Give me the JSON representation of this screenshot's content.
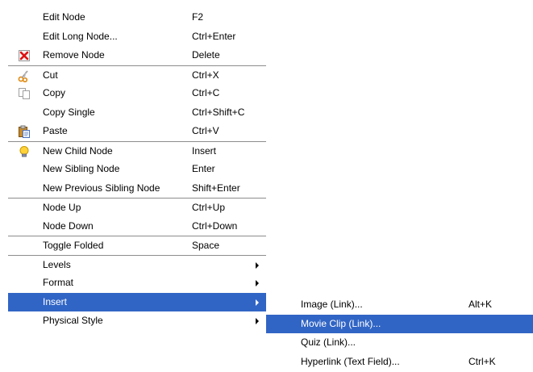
{
  "context_menu": {
    "items": [
      {
        "label": "Edit Node",
        "shortcut": "F2"
      },
      {
        "label": "Edit Long Node...",
        "shortcut": "Ctrl+Enter"
      },
      {
        "label": "Remove Node",
        "shortcut": "Delete",
        "icon": "remove-icon"
      },
      {
        "label": "Cut",
        "shortcut": "Ctrl+X",
        "icon": "scissors-icon"
      },
      {
        "label": "Copy",
        "shortcut": "Ctrl+C",
        "icon": "copy-icon"
      },
      {
        "label": "Copy Single",
        "shortcut": "Ctrl+Shift+C"
      },
      {
        "label": "Paste",
        "shortcut": "Ctrl+V",
        "icon": "paste-icon"
      },
      {
        "label": "New Child Node",
        "shortcut": "Insert",
        "icon": "lightbulb-icon"
      },
      {
        "label": "New Sibling Node",
        "shortcut": "Enter"
      },
      {
        "label": "New Previous Sibling Node",
        "shortcut": "Shift+Enter"
      },
      {
        "label": "Node Up",
        "shortcut": "Ctrl+Up"
      },
      {
        "label": "Node Down",
        "shortcut": "Ctrl+Down"
      },
      {
        "label": "Toggle Folded",
        "shortcut": "Space"
      },
      {
        "label": "Levels"
      },
      {
        "label": "Format"
      },
      {
        "label": "Insert"
      },
      {
        "label": "Physical Style"
      }
    ]
  },
  "insert_submenu": {
    "items": [
      {
        "label": "Image (Link)...",
        "shortcut": "Alt+K"
      },
      {
        "label": "Movie Clip (Link)...",
        "shortcut": ""
      },
      {
        "label": "Quiz (Link)...",
        "shortcut": ""
      },
      {
        "label": "Hyperlink (Text Field)...",
        "shortcut": "Ctrl+K"
      }
    ]
  },
  "colors": {
    "selection": "#3165c5",
    "separator": "#8d8d8d"
  }
}
